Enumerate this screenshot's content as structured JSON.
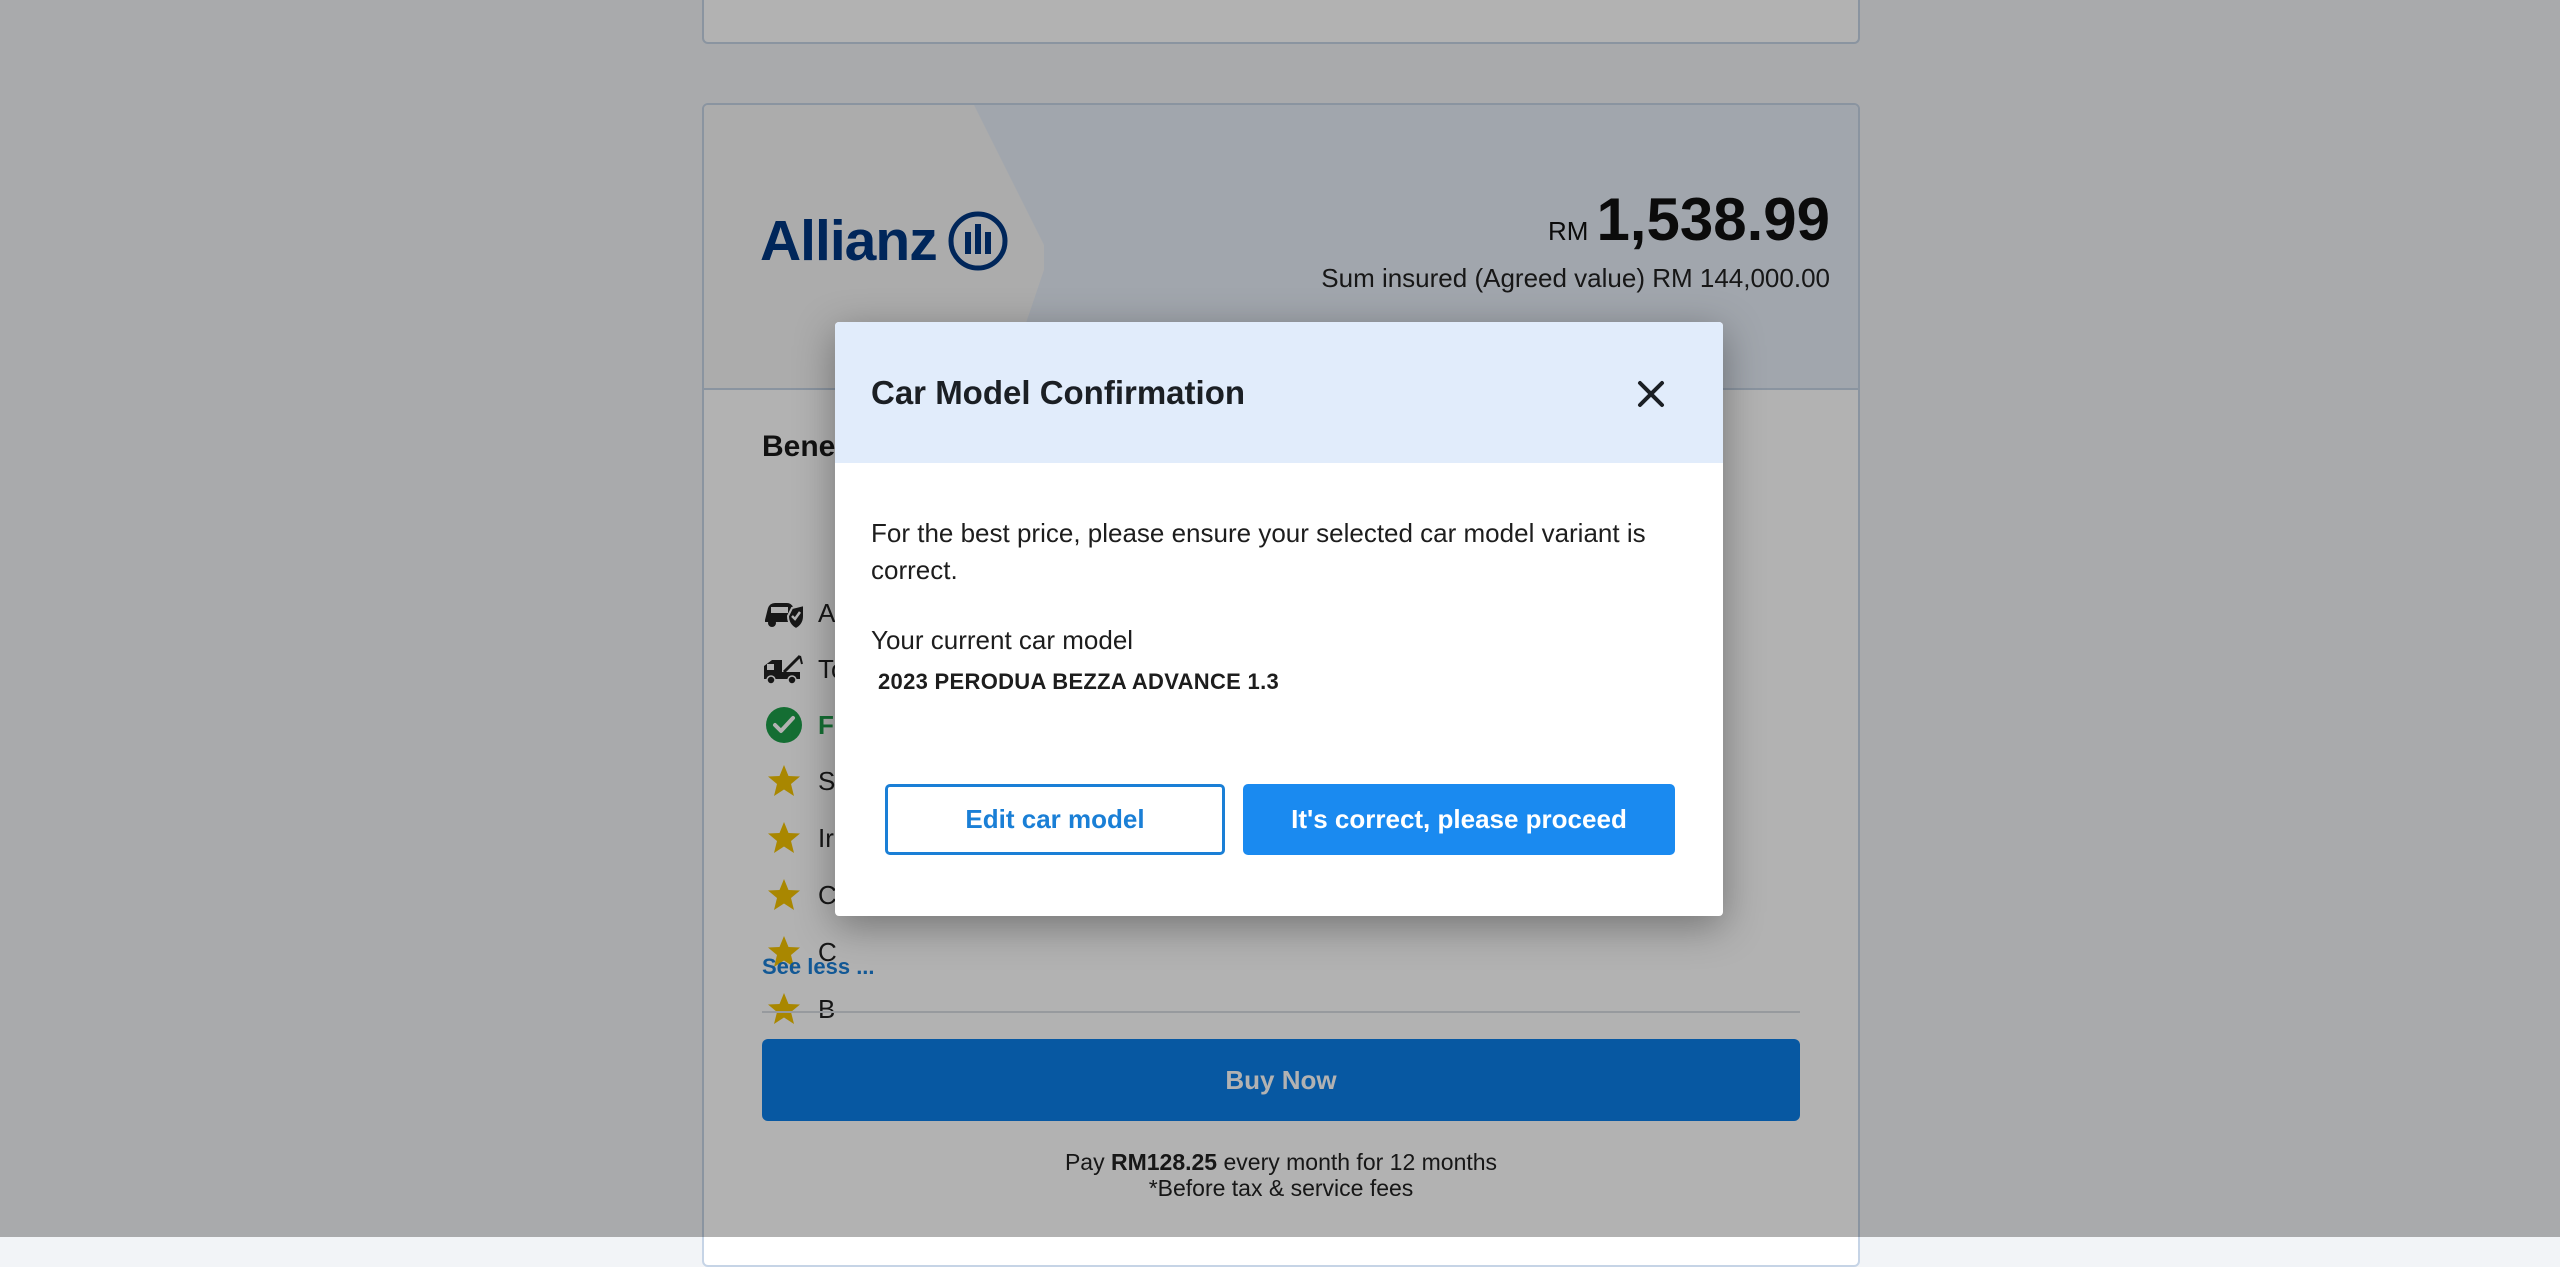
{
  "quote_card": {
    "insurer_logo": "Allianz",
    "price_currency": "RM",
    "price_value": "1,538.99",
    "sum_insured": "Sum insured (Agreed value) RM 144,000.00",
    "benefits_title": "Bene",
    "benefits": [
      {
        "icon": "car-shield-icon",
        "label": "A"
      },
      {
        "icon": "tow-truck-icon",
        "label": "To"
      },
      {
        "icon": "check-circle-icon",
        "label": "F"
      },
      {
        "icon": "star-icon",
        "label": "S"
      },
      {
        "icon": "star-icon",
        "label": "Ir"
      },
      {
        "icon": "star-icon",
        "label": "C"
      },
      {
        "icon": "star-icon",
        "label": "C"
      },
      {
        "icon": "star-icon",
        "label": "B"
      }
    ],
    "see_less": "See less ...",
    "buy_label": "Buy Now",
    "pay_prefix": "Pay ",
    "pay_amount": "RM128.25",
    "pay_suffix": " every month for 12 months",
    "pay_note": "*Before tax & service fees"
  },
  "modal": {
    "title": "Car Model Confirmation",
    "body": "For the best price, please ensure your selected car model variant is correct.",
    "current_label": "Your current car model",
    "current_model": "2023 PERODUA BEZZA ADVANCE 1.3",
    "edit_label": "Edit car model",
    "confirm_label": "It's correct, please proceed"
  },
  "colors": {
    "brand_blue": "#1a7fd6",
    "header_tint": "#e1ecfb",
    "star": "#f2c200",
    "check": "#1e9e4a",
    "allianz_navy": "#003781"
  }
}
